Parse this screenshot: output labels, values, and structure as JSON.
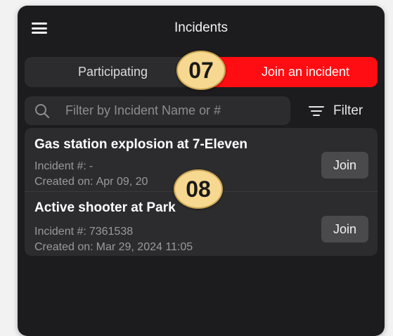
{
  "header": {
    "title": "Incidents"
  },
  "segments": {
    "participating": "Participating",
    "join": "Join an incident"
  },
  "search": {
    "placeholder": "Filter by Incident Name or #",
    "value": ""
  },
  "filter": {
    "label": "Filter"
  },
  "incidents": [
    {
      "name": "Gas station explosion at 7-Eleven",
      "number_label": "Incident #:",
      "number": "-",
      "created_label": "Created on:",
      "created": "Apr 09, 20",
      "action": "Join"
    },
    {
      "name": "Active shooter at Park",
      "number_label": "Incident #:",
      "number": "7361538",
      "created_label": "Created on:",
      "created": "Mar 29, 2024 11:05",
      "action": "Join"
    }
  ],
  "callouts": {
    "c7": "07",
    "c8": "08"
  },
  "colors": {
    "accent": "#ff0d12",
    "background": "#1c1c1e",
    "callout": "#f7d890"
  },
  "icons": {
    "menu": "hamburger-menu-icon",
    "search": "search-icon",
    "filter": "filter-lines-icon"
  }
}
